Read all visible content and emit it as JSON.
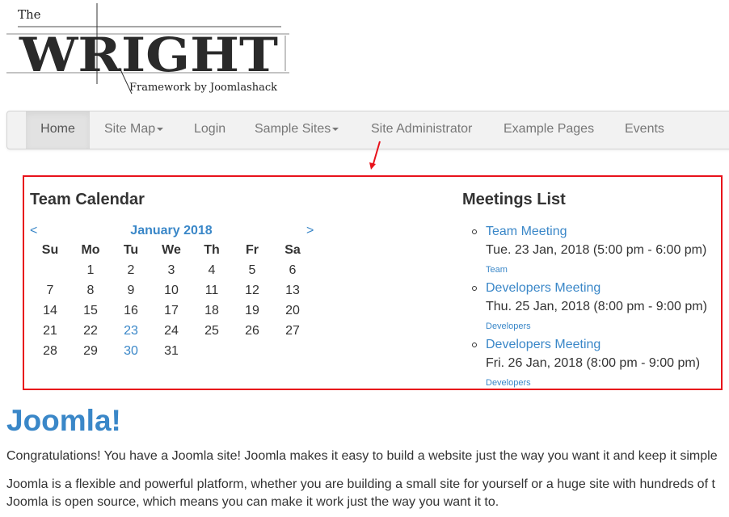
{
  "logo": {
    "text_the": "The",
    "text_main": "WRIGHT",
    "text_sub": "Framework by Joomlashack"
  },
  "nav": {
    "items": [
      {
        "label": "Home",
        "active": true
      },
      {
        "label": "Site Map",
        "caret": true
      },
      {
        "label": "Login"
      },
      {
        "label": "Sample Sites",
        "caret": true
      },
      {
        "label": "Site Administrator"
      },
      {
        "label": "Example Pages"
      },
      {
        "label": "Events"
      }
    ]
  },
  "annotation": {
    "color": "#e8121b"
  },
  "calendar": {
    "title": "Team Calendar",
    "month": "January 2018",
    "prev": "<",
    "next": ">",
    "days": [
      "Su",
      "Mo",
      "Tu",
      "We",
      "Th",
      "Fr",
      "Sa"
    ],
    "weeks": [
      [
        "",
        "1",
        "2",
        "3",
        "4",
        "5",
        "6"
      ],
      [
        "7",
        "8",
        "9",
        "10",
        "11",
        "12",
        "13"
      ],
      [
        "14",
        "15",
        "16",
        "17",
        "18",
        "19",
        "20"
      ],
      [
        "21",
        "22",
        "23",
        "24",
        "25",
        "26",
        "27"
      ],
      [
        "28",
        "29",
        "30",
        "31",
        "",
        "",
        ""
      ]
    ],
    "event_days": [
      "23",
      "30"
    ]
  },
  "meetings": {
    "title": "Meetings List",
    "items": [
      {
        "title": "Team Meeting",
        "date": "Tue. 23 Jan, 2018 (5:00 pm - 6:00 pm)",
        "category": "Team"
      },
      {
        "title": "Developers Meeting",
        "date": "Thu. 25 Jan, 2018 (8:00 pm - 9:00 pm)",
        "category": "Developers"
      },
      {
        "title": "Developers Meeting",
        "date": "Fri. 26 Jan, 2018 (8:00 pm - 9:00 pm)",
        "category": "Developers"
      }
    ]
  },
  "article": {
    "title": "Joomla!",
    "p1": "Congratulations! You have a Joomla site! Joomla makes it easy to build a website just the way you want it and keep it simple",
    "p2a": "Joomla is a flexible and powerful platform, whether you are building a small site for yourself or a huge site with hundreds of t",
    "p2b": "Joomla is open source, which means you can make it work just the way you want it to."
  },
  "colors": {
    "link": "#3a87c8",
    "accent_box": "#e8121b"
  }
}
